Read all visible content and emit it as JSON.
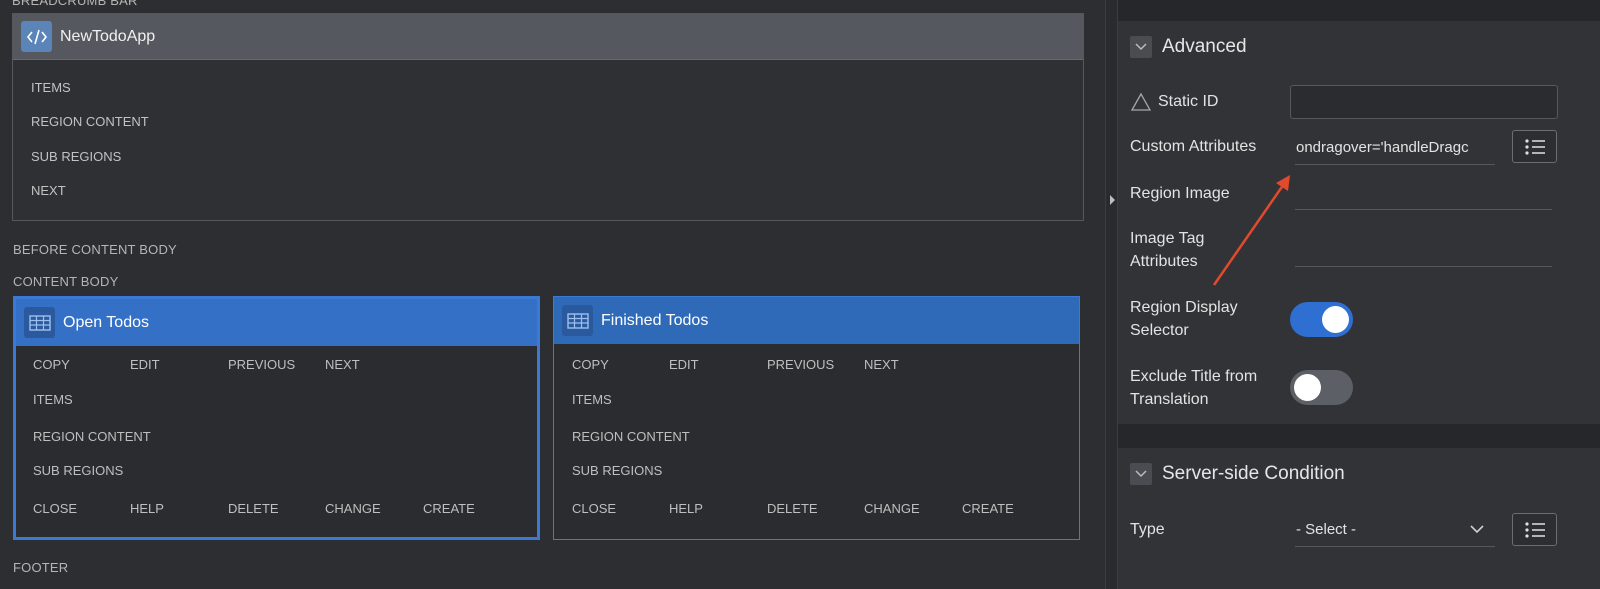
{
  "layout": {
    "breadcrumb_bar_label": "BREADCRUMB BAR",
    "breadcrumb_region": {
      "title": "NewTodoApp",
      "slots": [
        "ITEMS",
        "REGION CONTENT",
        "SUB REGIONS",
        "NEXT"
      ]
    },
    "before_content_body": "BEFORE CONTENT BODY",
    "content_body": "CONTENT BODY",
    "footer": "FOOTER",
    "regions": [
      {
        "title": "Open Todos",
        "top_buttons": [
          "COPY",
          "EDIT",
          "PREVIOUS",
          "NEXT"
        ],
        "slots": [
          "ITEMS",
          "REGION CONTENT",
          "SUB REGIONS"
        ],
        "bottom_buttons": [
          "CLOSE",
          "HELP",
          "DELETE",
          "CHANGE",
          "CREATE"
        ]
      },
      {
        "title": "Finished Todos",
        "top_buttons": [
          "COPY",
          "EDIT",
          "PREVIOUS",
          "NEXT"
        ],
        "slots": [
          "ITEMS",
          "REGION CONTENT",
          "SUB REGIONS"
        ],
        "bottom_buttons": [
          "CLOSE",
          "HELP",
          "DELETE",
          "CHANGE",
          "CREATE"
        ]
      }
    ]
  },
  "panel": {
    "advanced": {
      "title": "Advanced",
      "static_id_label": "Static ID",
      "static_id_value": "",
      "custom_attributes_label": "Custom Attributes",
      "custom_attributes_value": "ondragover='handleDragc",
      "region_image_label": "Region Image",
      "image_tag_attributes_label_1": "Image Tag",
      "image_tag_attributes_label_2": "Attributes",
      "region_display_selector_label_1": "Region Display",
      "region_display_selector_label_2": "Selector",
      "region_display_selector_on": true,
      "exclude_title_label_1": "Exclude Title from",
      "exclude_title_label_2": "Translation",
      "exclude_title_on": false
    },
    "server_side_condition": {
      "title": "Server-side Condition",
      "type_label": "Type",
      "type_value": "- Select -"
    }
  },
  "colors": {
    "toggle_on": "#2f6fd1",
    "toggle_off": "#5c5f65",
    "annotation_arrow": "#e24a2d",
    "region_header": "#2e6ab8"
  },
  "icons": [
    "code-icon",
    "grid-icon",
    "chevron-down-icon",
    "list-icon",
    "warning-triangle-icon"
  ]
}
